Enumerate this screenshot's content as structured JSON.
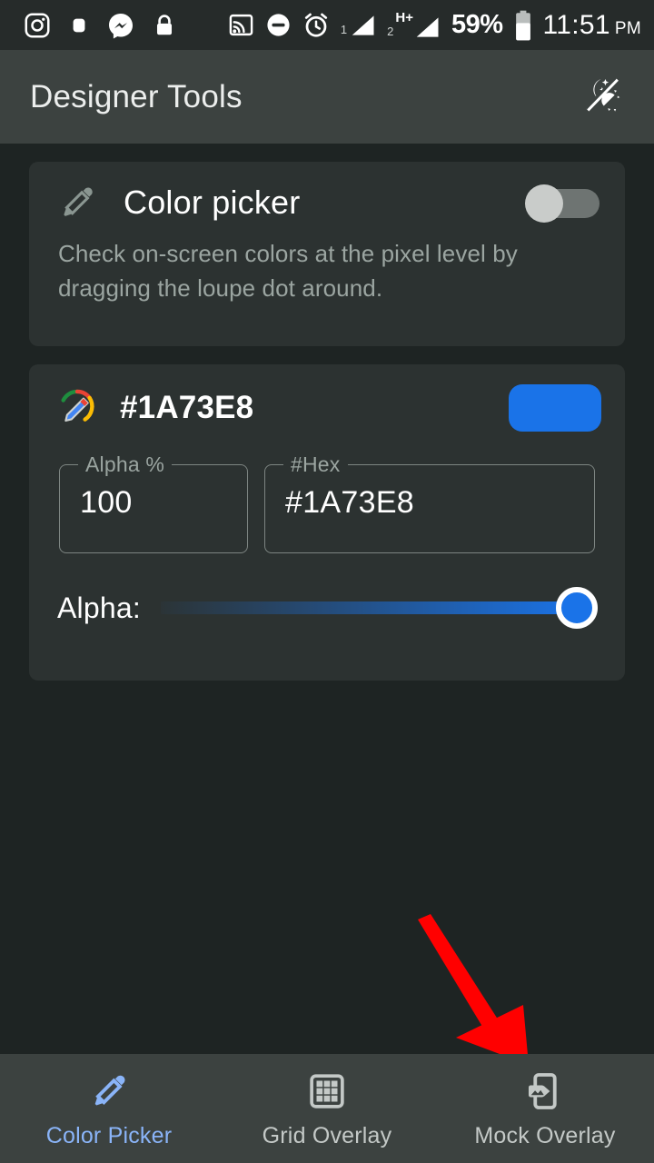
{
  "status_bar": {
    "icons": [
      {
        "name": "instagram-icon"
      },
      {
        "name": "screen-record-icon"
      },
      {
        "name": "messenger-icon"
      },
      {
        "name": "lock-icon"
      },
      {
        "name": "cast-icon"
      },
      {
        "name": "do-not-disturb-icon"
      },
      {
        "name": "alarm-icon"
      }
    ],
    "sim1_label": "1",
    "sim2_label": "2",
    "network_type": "H+",
    "battery_percent": "59%",
    "time": "11:51",
    "meridiem": "PM"
  },
  "app_bar": {
    "title": "Designer Tools",
    "theme_toggle_icon": "day-night-toggle-icon"
  },
  "color_picker_card": {
    "icon": "eyedropper-icon",
    "title": "Color picker",
    "description": "Check on-screen colors at the pixel level by dragging the loupe dot around.",
    "toggle_state": "off"
  },
  "color_card": {
    "icon": "color-palette-pencil-icon",
    "hex_title": "#1A73E8",
    "swatch_color": "#1A73E8",
    "alpha_field": {
      "label": "Alpha %",
      "value": "100"
    },
    "hex_field": {
      "label": "#Hex",
      "value": "#1A73E8"
    },
    "alpha_slider": {
      "label": "Alpha:",
      "value": 100,
      "min": 0,
      "max": 100,
      "accent_color": "#1A73E8"
    }
  },
  "annotation": {
    "arrow_color": "#FF0000",
    "points_to": "Mock Overlay"
  },
  "bottom_nav": {
    "active_index": 0,
    "active_color": "#8AB4F8",
    "items": [
      {
        "label": "Color Picker",
        "icon": "eyedropper-icon"
      },
      {
        "label": "Grid Overlay",
        "icon": "grid-icon"
      },
      {
        "label": "Mock Overlay",
        "icon": "mock-overlay-icon"
      }
    ]
  }
}
